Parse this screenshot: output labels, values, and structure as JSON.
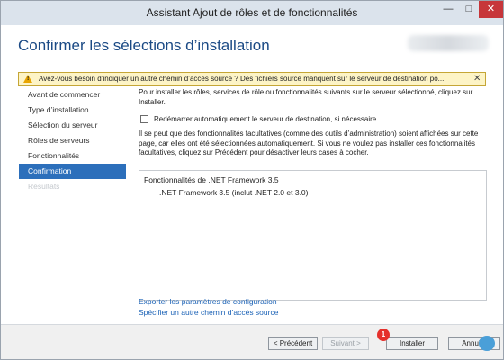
{
  "window": {
    "title": "Assistant Ajout de rôles et de fonctionnalités",
    "minimize_glyph": "—",
    "maximize_glyph": "□",
    "close_glyph": "✕"
  },
  "header": {
    "page_title": "Confirmer les sélections d’installation"
  },
  "warning": {
    "text": "Avez-vous besoin d’indiquer un autre chemin d’accès source ? Des fichiers source manquent sur le serveur de destination po...",
    "close_glyph": "✕",
    "icon_glyph": "!"
  },
  "nav": {
    "items": [
      {
        "label": "Avant de commencer",
        "state": "normal"
      },
      {
        "label": "Type d’installation",
        "state": "normal"
      },
      {
        "label": "Sélection du serveur",
        "state": "normal"
      },
      {
        "label": "Rôles de serveurs",
        "state": "normal"
      },
      {
        "label": "Fonctionnalités",
        "state": "normal"
      },
      {
        "label": "Confirmation",
        "state": "active"
      },
      {
        "label": "Résultats",
        "state": "disabled"
      }
    ]
  },
  "content": {
    "intro": "Pour installer les rôles, services de rôle ou fonctionnalités suivants sur le serveur sélectionné, cliquez sur Installer.",
    "restart_checkbox_label": "Redémarrer automatiquement le serveur de destination, si nécessaire",
    "note": "Il se peut que des fonctionnalités facultatives (comme des outils d’administration) soient affichées sur cette page, car elles ont été sélectionnées automatiquement. Si vous ne voulez pas installer ces fonctionnalités facultatives, cliquez sur Précédent pour désactiver leurs cases à cocher.",
    "features": {
      "group": "Fonctionnalités de .NET Framework 3.5",
      "child": ".NET Framework 3.5 (inclut .NET 2.0 et 3.0)"
    },
    "links": {
      "export": "Exporter les paramètres de configuration",
      "alt_source": "Spécifier un autre chemin d’accès source"
    }
  },
  "footer": {
    "prev": "< Précédent",
    "next": "Suivant >",
    "install": "Installer",
    "cancel": "Annuler",
    "step_badge": "1"
  },
  "colors": {
    "accent": "#2c6fbb",
    "title_blue": "#1b4a85",
    "link": "#1b62b6",
    "warning_bg": "#fdf4c6",
    "close_red": "#c7363a",
    "badge_red": "#e5312c"
  }
}
